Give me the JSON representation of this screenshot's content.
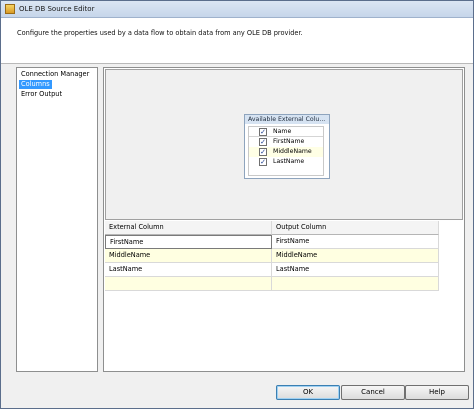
{
  "window": {
    "title": "OLE DB Source Editor"
  },
  "header": {
    "description": "Configure the properties used by a data flow to obtain data from any OLE DB provider."
  },
  "nav": {
    "items": [
      {
        "label": "Connection Manager"
      },
      {
        "label": "Columns"
      },
      {
        "label": "Error Output"
      }
    ],
    "selected": "Columns"
  },
  "external_columns": {
    "title": "Available External Colu...",
    "header_label": "Name",
    "items": [
      {
        "label": "FirstName",
        "checked": true
      },
      {
        "label": "MiddleName",
        "checked": true
      },
      {
        "label": "LastName",
        "checked": true
      }
    ]
  },
  "mapping_grid": {
    "columns": [
      "External Column",
      "Output Column"
    ],
    "rows": [
      [
        "FirstName",
        "FirstName"
      ],
      [
        "MiddleName",
        "MiddleName"
      ],
      [
        "LastName",
        "LastName"
      ]
    ]
  },
  "buttons": {
    "ok": "OK",
    "cancel": "Cancel",
    "help": "Help"
  },
  "icons": {
    "check": "✓"
  },
  "colors": {
    "selection": "#3399ff",
    "title_bar": "#c6d6ea",
    "row_highlight": "#ffffe1"
  }
}
